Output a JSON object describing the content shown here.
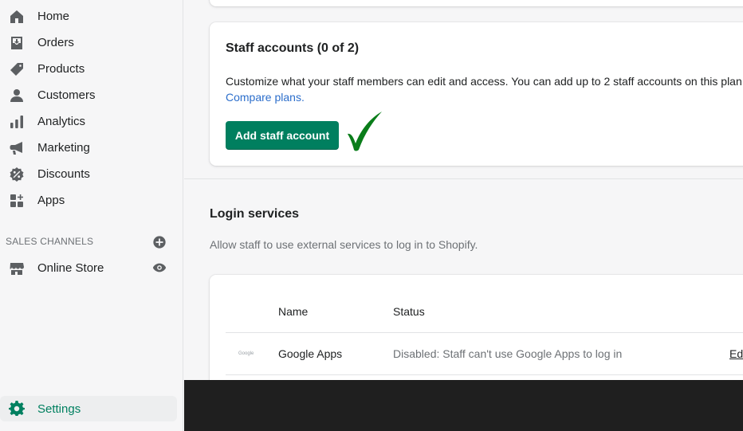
{
  "sidebar": {
    "items": [
      {
        "label": "Home",
        "icon": "home-icon"
      },
      {
        "label": "Orders",
        "icon": "orders-icon"
      },
      {
        "label": "Products",
        "icon": "tag-icon"
      },
      {
        "label": "Customers",
        "icon": "person-icon"
      },
      {
        "label": "Analytics",
        "icon": "bar-chart-icon"
      },
      {
        "label": "Marketing",
        "icon": "megaphone-icon"
      },
      {
        "label": "Discounts",
        "icon": "discount-icon"
      },
      {
        "label": "Apps",
        "icon": "apps-icon"
      }
    ],
    "sales_channels_label": "SALES CHANNELS",
    "channels": [
      {
        "label": "Online Store",
        "icon": "store-icon"
      }
    ],
    "settings_label": "Settings"
  },
  "staff_card": {
    "title": "Staff accounts (0 of 2)",
    "description": "Customize what your staff members can edit and access. You can add up to 2 staff accounts on this plan.",
    "link": "Compare plans.",
    "button": "Add staff account"
  },
  "login_services": {
    "title": "Login services",
    "description": "Allow staff to use external services to log in to Shopify.",
    "columns": [
      "Name",
      "Status"
    ],
    "rows": [
      {
        "logo": "Google",
        "name": "Google Apps",
        "status": "Disabled: Staff can't use Google Apps to log in",
        "action": "Edi"
      }
    ]
  },
  "colors": {
    "primary": "#007f5f",
    "active_nav": "#008060",
    "link": "#2c6ecb",
    "checkmark": "#0a7d1a",
    "dark_bar": "#1f1f1f"
  }
}
